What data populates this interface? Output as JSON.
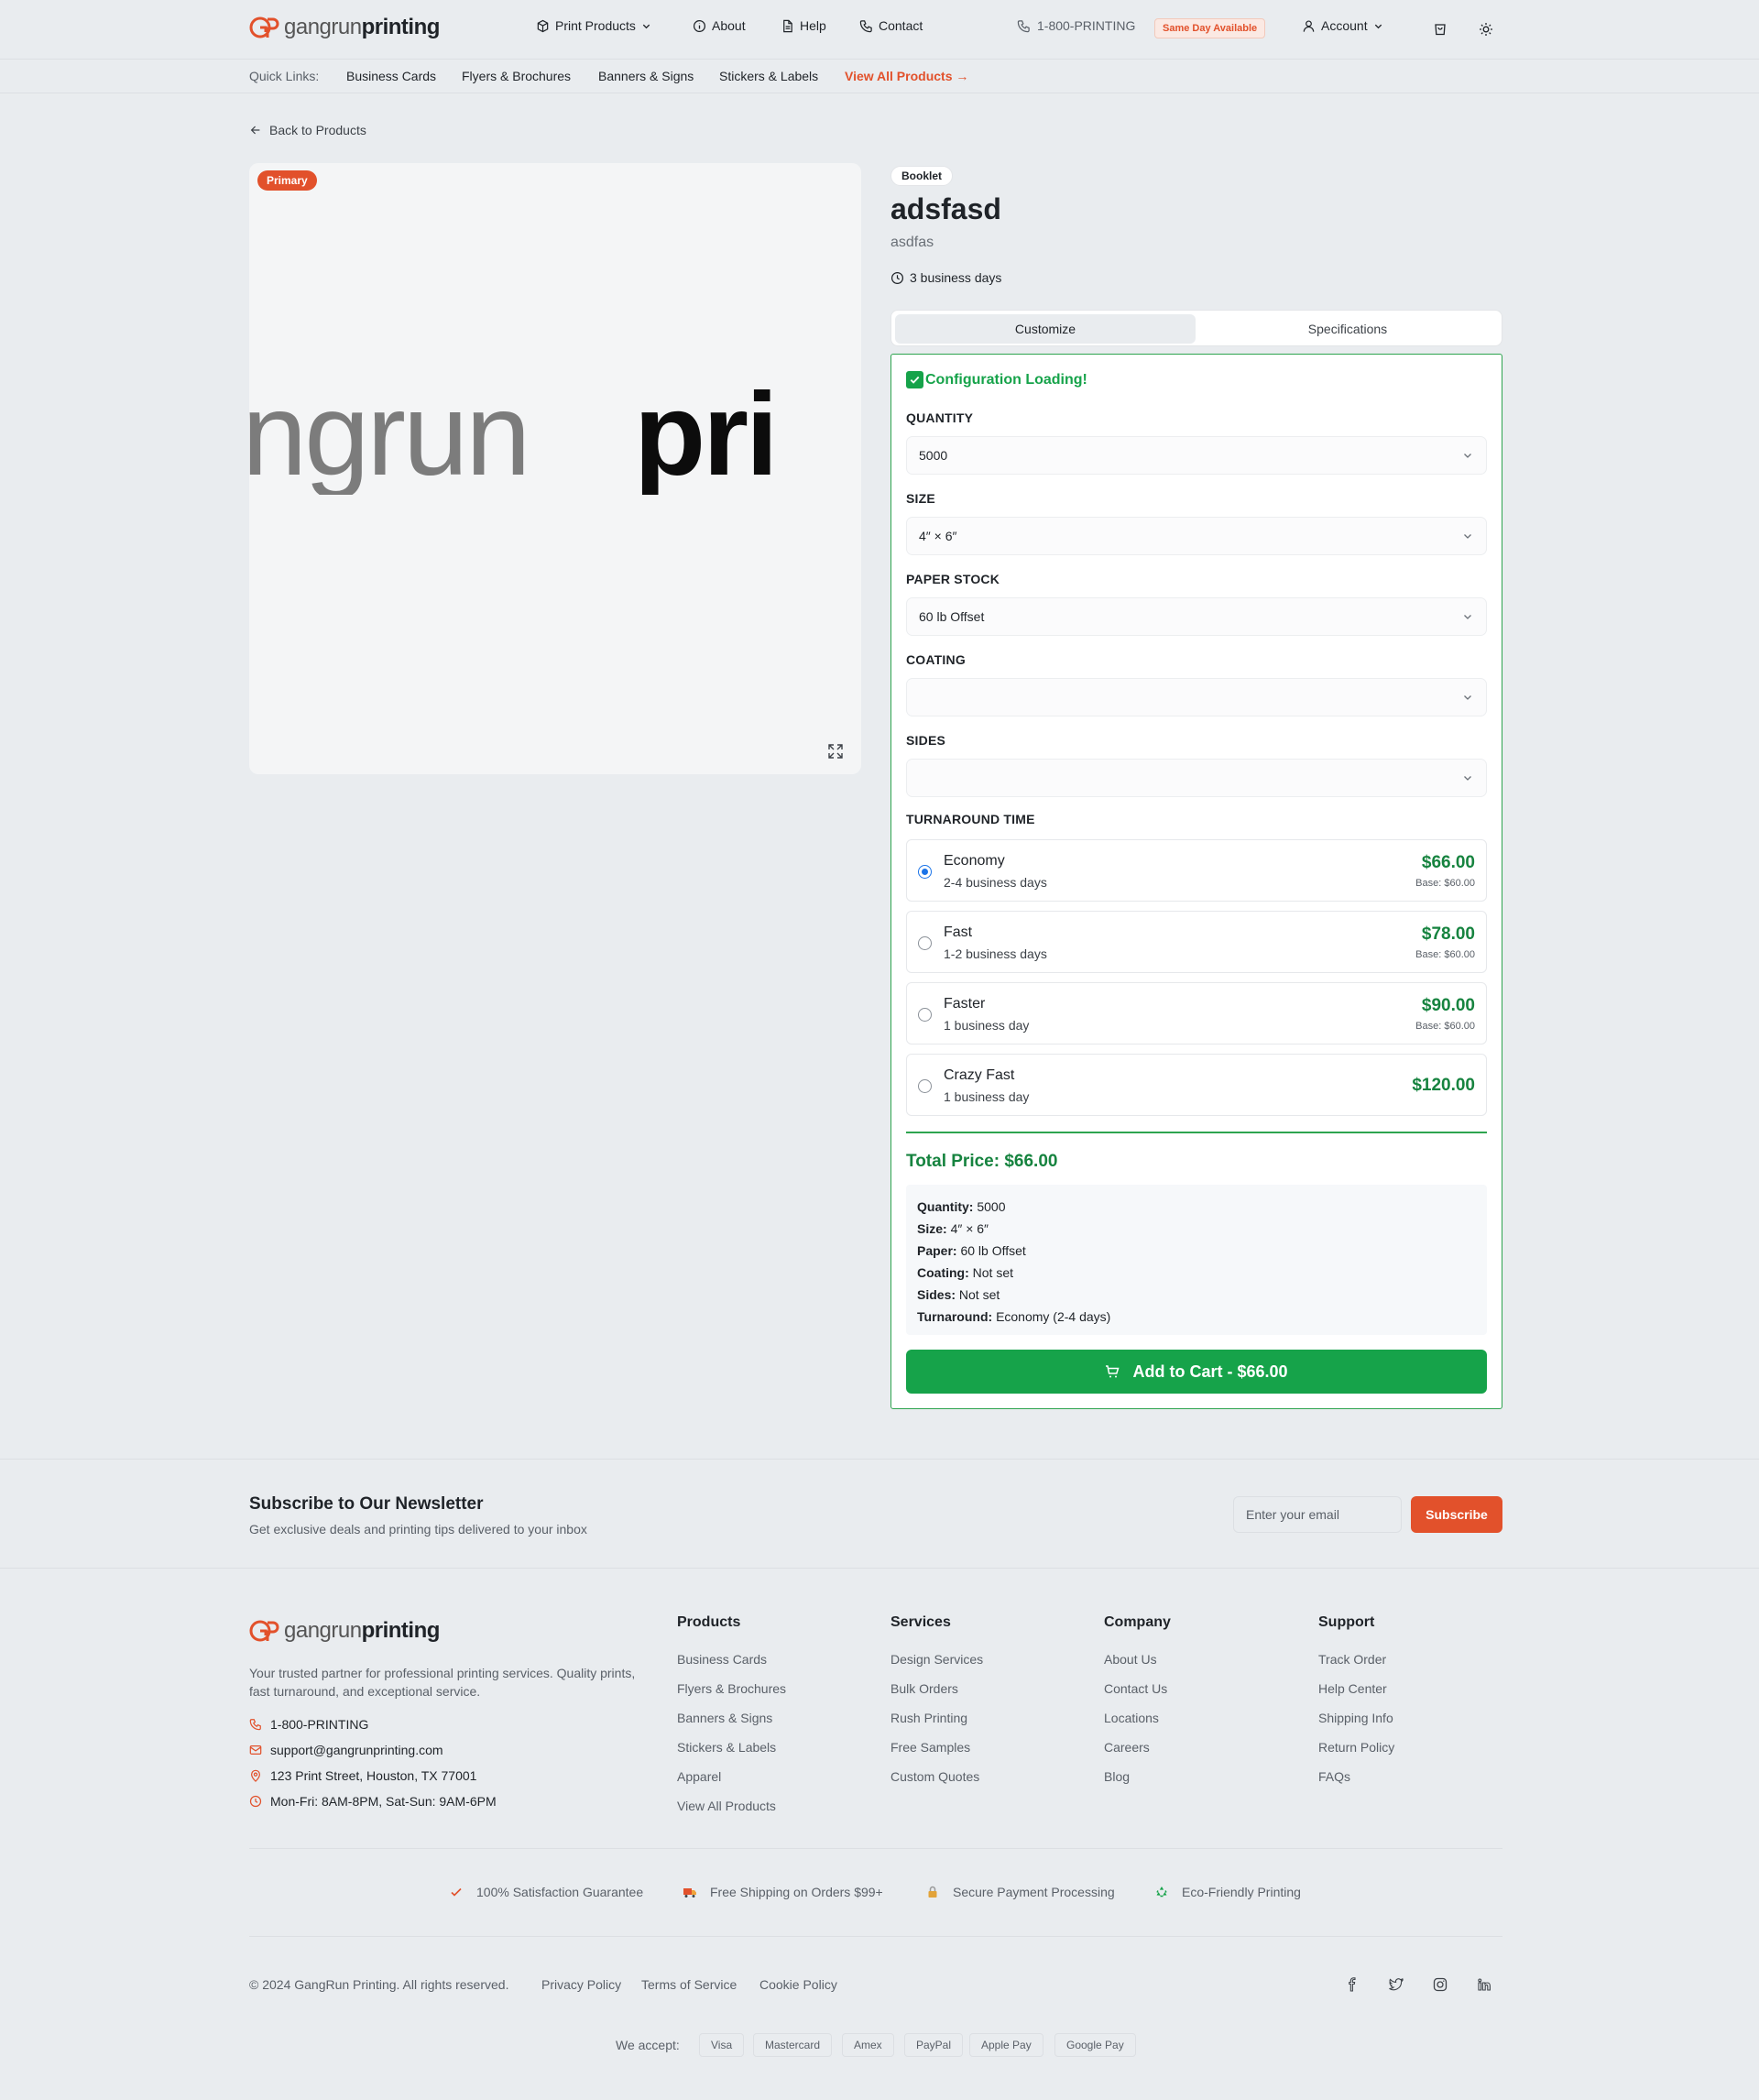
{
  "header": {
    "logo_prefix": "gangrun",
    "logo_suffix": "printing",
    "nav": {
      "print_products": "Print Products",
      "about": "About",
      "help": "Help",
      "contact": "Contact"
    },
    "phone": "1-800-PRINTING",
    "same_day_badge": "Same Day Available",
    "account": "Account"
  },
  "quick_links": {
    "label": "Quick Links:",
    "items": [
      "Business Cards",
      "Flyers & Brochures",
      "Banners & Signs",
      "Stickers & Labels"
    ],
    "view_all": "View All Products →"
  },
  "back_link": "Back to Products",
  "gallery": {
    "primary_badge": "Primary",
    "image_text_light": "ngrun",
    "image_text_dark": "pri"
  },
  "product": {
    "category": "Booklet",
    "name": "adsfasd",
    "description": "asdfas",
    "turnaround": "3 business days"
  },
  "tabs": {
    "customize": "Customize",
    "specifications": "Specifications",
    "active": "customize"
  },
  "config": {
    "heading": "Configuration Loading!",
    "quantity_label": "QUANTITY",
    "quantity_value": "5000",
    "size_label": "SIZE",
    "size_value": "4″ × 6″",
    "paper_label": "PAPER STOCK",
    "paper_value": "60 lb Offset",
    "coating_label": "COATING",
    "coating_value": "",
    "sides_label": "SIDES",
    "sides_value": "",
    "turnaround_label": "TURNAROUND TIME",
    "turnaround_options": [
      {
        "name": "Economy",
        "days": "2-4 business days",
        "price": "$66.00",
        "base": "Base: $60.00",
        "selected": true
      },
      {
        "name": "Fast",
        "days": "1-2 business days",
        "price": "$78.00",
        "base": "Base: $60.00",
        "selected": false
      },
      {
        "name": "Faster",
        "days": "1 business day",
        "price": "$90.00",
        "base": "Base: $60.00",
        "selected": false
      },
      {
        "name": "Crazy Fast",
        "days": "1 business day",
        "price": "$120.00",
        "base": "",
        "selected": false
      }
    ],
    "total": "Total Price: $66.00",
    "summary": {
      "quantity_label": "Quantity:",
      "quantity": "5000",
      "size_label": "Size:",
      "size": "4″ × 6″",
      "paper_label": "Paper:",
      "paper": "60 lb Offset",
      "coating_label": "Coating:",
      "coating": "Not set",
      "sides_label": "Sides:",
      "sides": "Not set",
      "turnaround_label": "Turnaround:",
      "turnaround": "Economy (2-4 days)"
    },
    "add_to_cart": "Add to Cart - $66.00"
  },
  "newsletter": {
    "title": "Subscribe to Our Newsletter",
    "subtitle": "Get exclusive deals and printing tips delivered to your inbox",
    "placeholder": "Enter your email",
    "button": "Subscribe"
  },
  "footer": {
    "description": "Your trusted partner for professional printing services. Quality prints, fast turnaround, and exceptional service.",
    "phone": "1-800-PRINTING",
    "email": "support@gangrunprinting.com",
    "address": "123 Print Street, Houston, TX 77001",
    "hours": "Mon-Fri: 8AM-8PM, Sat-Sun: 9AM-6PM",
    "columns": [
      {
        "title": "Products",
        "links": [
          "Business Cards",
          "Flyers & Brochures",
          "Banners & Signs",
          "Stickers & Labels",
          "Apparel",
          "View All Products"
        ]
      },
      {
        "title": "Services",
        "links": [
          "Design Services",
          "Bulk Orders",
          "Rush Printing",
          "Free Samples",
          "Custom Quotes"
        ]
      },
      {
        "title": "Company",
        "links": [
          "About Us",
          "Contact Us",
          "Locations",
          "Careers",
          "Blog"
        ]
      },
      {
        "title": "Support",
        "links": [
          "Track Order",
          "Help Center",
          "Shipping Info",
          "Return Policy",
          "FAQs"
        ]
      }
    ],
    "features": [
      "100% Satisfaction Guarantee",
      "Free Shipping on Orders $99+",
      "Secure Payment Processing",
      "Eco-Friendly Printing"
    ],
    "copyright": "© 2024 GangRun Printing. All rights reserved.",
    "legal": [
      "Privacy Policy",
      "Terms of Service",
      "Cookie Policy"
    ],
    "social_icons": [
      "facebook-icon",
      "twitter-icon",
      "instagram-icon",
      "linkedin-icon"
    ],
    "we_accept": "We accept:",
    "payments": [
      "Visa",
      "Mastercard",
      "Amex",
      "PayPal",
      "Apple Pay",
      "Google Pay"
    ]
  },
  "colors": {
    "brand_orange": "#e2512b",
    "success_green": "#16a34a",
    "price_green": "#16833f",
    "radio_blue": "#1a73e8",
    "page_bg": "#e9ecef"
  }
}
